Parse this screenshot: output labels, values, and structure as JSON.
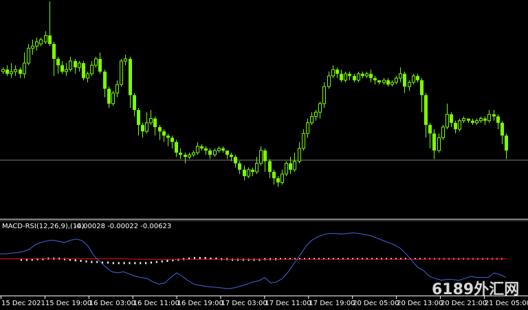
{
  "chart_data": [
    {
      "type": "candlestick",
      "colors": {
        "background": "#000000",
        "candle": "#7cfc00",
        "bid_line": "#808080"
      },
      "ylim": [
        0,
        1
      ],
      "bid_level": 0.255,
      "candles": [
        [
          0.67,
          0.68,
          0.66,
          0.69
        ],
        [
          0.68,
          0.66,
          0.65,
          0.7
        ],
        [
          0.66,
          0.67,
          0.64,
          0.71
        ],
        [
          0.67,
          0.68,
          0.65,
          0.7
        ],
        [
          0.68,
          0.66,
          0.64,
          0.69
        ],
        [
          0.66,
          0.71,
          0.64,
          0.76
        ],
        [
          0.71,
          0.78,
          0.7,
          0.8
        ],
        [
          0.78,
          0.79,
          0.75,
          0.82
        ],
        [
          0.79,
          0.81,
          0.77,
          0.83
        ],
        [
          0.8,
          0.82,
          0.79,
          0.83
        ],
        [
          0.81,
          0.84,
          0.8,
          0.86
        ],
        [
          0.84,
          0.8,
          0.79,
          1.0
        ],
        [
          0.8,
          0.73,
          0.65,
          0.81
        ],
        [
          0.73,
          0.7,
          0.66,
          0.74
        ],
        [
          0.7,
          0.67,
          0.66,
          0.72
        ],
        [
          0.67,
          0.68,
          0.65,
          0.71
        ],
        [
          0.68,
          0.72,
          0.67,
          0.74
        ],
        [
          0.72,
          0.69,
          0.66,
          0.73
        ],
        [
          0.69,
          0.71,
          0.67,
          0.72
        ],
        [
          0.71,
          0.64,
          0.63,
          0.72
        ],
        [
          0.64,
          0.66,
          0.62,
          0.67
        ],
        [
          0.66,
          0.7,
          0.65,
          0.72
        ],
        [
          0.7,
          0.73,
          0.69,
          0.74
        ],
        [
          0.73,
          0.67,
          0.66,
          0.76
        ],
        [
          0.67,
          0.59,
          0.55,
          0.68
        ],
        [
          0.59,
          0.52,
          0.5,
          0.6
        ],
        [
          0.52,
          0.57,
          0.51,
          0.58
        ],
        [
          0.57,
          0.61,
          0.55,
          0.63
        ],
        [
          0.61,
          0.72,
          0.6,
          0.73
        ],
        [
          0.72,
          0.73,
          0.7,
          0.75
        ],
        [
          0.73,
          0.56,
          0.5,
          0.74
        ],
        [
          0.56,
          0.49,
          0.46,
          0.57
        ],
        [
          0.49,
          0.42,
          0.37,
          0.5
        ],
        [
          0.42,
          0.39,
          0.36,
          0.43
        ],
        [
          0.39,
          0.43,
          0.38,
          0.48
        ],
        [
          0.43,
          0.45,
          0.42,
          0.49
        ],
        [
          0.45,
          0.41,
          0.37,
          0.46
        ],
        [
          0.41,
          0.39,
          0.35,
          0.42
        ],
        [
          0.39,
          0.37,
          0.34,
          0.4
        ],
        [
          0.37,
          0.36,
          0.32,
          0.38
        ],
        [
          0.36,
          0.34,
          0.31,
          0.37
        ],
        [
          0.34,
          0.29,
          0.27,
          0.35
        ],
        [
          0.29,
          0.28,
          0.26,
          0.31
        ],
        [
          0.28,
          0.27,
          0.24,
          0.29
        ],
        [
          0.27,
          0.28,
          0.26,
          0.29
        ],
        [
          0.28,
          0.29,
          0.27,
          0.3
        ],
        [
          0.29,
          0.32,
          0.28,
          0.34
        ],
        [
          0.32,
          0.31,
          0.3,
          0.33
        ],
        [
          0.31,
          0.3,
          0.28,
          0.32
        ],
        [
          0.3,
          0.28,
          0.26,
          0.31
        ],
        [
          0.28,
          0.3,
          0.27,
          0.31
        ],
        [
          0.3,
          0.31,
          0.29,
          0.32
        ],
        [
          0.31,
          0.3,
          0.29,
          0.32
        ],
        [
          0.3,
          0.28,
          0.26,
          0.3
        ],
        [
          0.28,
          0.27,
          0.25,
          0.29
        ],
        [
          0.27,
          0.24,
          0.22,
          0.28
        ],
        [
          0.24,
          0.21,
          0.19,
          0.25
        ],
        [
          0.21,
          0.18,
          0.16,
          0.23
        ],
        [
          0.18,
          0.21,
          0.17,
          0.22
        ],
        [
          0.21,
          0.2,
          0.18,
          0.22
        ],
        [
          0.2,
          0.24,
          0.19,
          0.27
        ],
        [
          0.24,
          0.3,
          0.23,
          0.32
        ],
        [
          0.3,
          0.25,
          0.2,
          0.31
        ],
        [
          0.25,
          0.2,
          0.17,
          0.26
        ],
        [
          0.2,
          0.17,
          0.14,
          0.21
        ],
        [
          0.17,
          0.15,
          0.13,
          0.18
        ],
        [
          0.15,
          0.19,
          0.14,
          0.21
        ],
        [
          0.19,
          0.24,
          0.18,
          0.25
        ],
        [
          0.24,
          0.21,
          0.19,
          0.27
        ],
        [
          0.21,
          0.25,
          0.2,
          0.29
        ],
        [
          0.25,
          0.31,
          0.24,
          0.34
        ],
        [
          0.31,
          0.38,
          0.3,
          0.4
        ],
        [
          0.38,
          0.43,
          0.36,
          0.45
        ],
        [
          0.43,
          0.46,
          0.42,
          0.48
        ],
        [
          0.46,
          0.48,
          0.44,
          0.49
        ],
        [
          0.48,
          0.52,
          0.45,
          0.53
        ],
        [
          0.52,
          0.6,
          0.5,
          0.62
        ],
        [
          0.6,
          0.65,
          0.59,
          0.67
        ],
        [
          0.65,
          0.68,
          0.64,
          0.7
        ],
        [
          0.68,
          0.66,
          0.64,
          0.69
        ],
        [
          0.66,
          0.63,
          0.62,
          0.68
        ],
        [
          0.63,
          0.66,
          0.62,
          0.67
        ],
        [
          0.66,
          0.65,
          0.63,
          0.67
        ],
        [
          0.65,
          0.63,
          0.62,
          0.66
        ],
        [
          0.63,
          0.66,
          0.62,
          0.67
        ],
        [
          0.66,
          0.65,
          0.64,
          0.67
        ],
        [
          0.65,
          0.66,
          0.64,
          0.67
        ],
        [
          0.66,
          0.64,
          0.62,
          0.68
        ],
        [
          0.64,
          0.63,
          0.61,
          0.65
        ],
        [
          0.63,
          0.62,
          0.61,
          0.63
        ],
        [
          0.62,
          0.63,
          0.61,
          0.64
        ],
        [
          0.63,
          0.61,
          0.6,
          0.64
        ],
        [
          0.61,
          0.62,
          0.6,
          0.63
        ],
        [
          0.62,
          0.64,
          0.61,
          0.65
        ],
        [
          0.64,
          0.66,
          0.62,
          0.69
        ],
        [
          0.66,
          0.6,
          0.57,
          0.67
        ],
        [
          0.6,
          0.62,
          0.58,
          0.63
        ],
        [
          0.62,
          0.65,
          0.61,
          0.66
        ],
        [
          0.65,
          0.63,
          0.62,
          0.66
        ],
        [
          0.63,
          0.56,
          0.48,
          0.64
        ],
        [
          0.56,
          0.42,
          0.36,
          0.57
        ],
        [
          0.42,
          0.38,
          0.31,
          0.43
        ],
        [
          0.38,
          0.3,
          0.26,
          0.4
        ],
        [
          0.3,
          0.36,
          0.29,
          0.38
        ],
        [
          0.36,
          0.41,
          0.35,
          0.42
        ],
        [
          0.41,
          0.47,
          0.4,
          0.52
        ],
        [
          0.47,
          0.43,
          0.41,
          0.48
        ],
        [
          0.43,
          0.4,
          0.38,
          0.44
        ],
        [
          0.4,
          0.44,
          0.39,
          0.45
        ],
        [
          0.44,
          0.45,
          0.43,
          0.46
        ],
        [
          0.45,
          0.44,
          0.43,
          0.45
        ],
        [
          0.44,
          0.43,
          0.42,
          0.45
        ],
        [
          0.43,
          0.44,
          0.42,
          0.45
        ],
        [
          0.44,
          0.45,
          0.43,
          0.46
        ],
        [
          0.45,
          0.44,
          0.42,
          0.46
        ],
        [
          0.44,
          0.47,
          0.43,
          0.49
        ],
        [
          0.47,
          0.46,
          0.44,
          0.49
        ],
        [
          0.46,
          0.43,
          0.4,
          0.47
        ],
        [
          0.43,
          0.37,
          0.33,
          0.44
        ],
        [
          0.37,
          0.3,
          0.26,
          0.38
        ]
      ]
    },
    {
      "type": "line",
      "name": "MACD-RSI(12,26,9),(14)",
      "values_label": "-0.00028 -0.00022 -0.00623",
      "colors": {
        "rsi": "#4169e1",
        "signal": "#ff0000",
        "macd_dots": "#ffffff"
      },
      "ylim": [
        0,
        1
      ],
      "rsi": [
        0.62,
        0.62,
        0.63,
        0.64,
        0.66,
        0.7,
        0.78,
        0.82,
        0.85,
        0.86,
        0.84,
        0.82,
        0.86,
        0.88,
        0.85,
        0.75,
        0.58,
        0.48,
        0.38,
        0.3,
        0.28,
        0.3,
        0.26,
        0.22,
        0.2,
        0.18,
        0.12,
        0.08,
        0.1,
        0.2,
        0.28,
        0.22,
        0.14,
        0.08,
        0.06,
        0.04,
        0.03,
        0.02,
        0.01,
        0.0,
        0.02,
        0.05,
        0.08,
        0.12,
        0.14,
        0.2,
        0.1,
        0.12,
        0.18,
        0.3,
        0.45,
        0.6,
        0.75,
        0.86,
        0.92,
        0.96,
        0.98,
        0.98,
        0.97,
        0.98,
        0.99,
        0.98,
        0.96,
        0.94,
        0.9,
        0.86,
        0.82,
        0.78,
        0.72,
        0.62,
        0.5,
        0.38,
        0.32,
        0.22,
        0.18,
        0.15,
        0.17,
        0.16,
        0.15,
        0.18,
        0.22,
        0.2,
        0.2,
        0.2,
        0.28,
        0.25,
        0.2
      ],
      "signal": [
        0.53,
        0.53,
        0.53,
        0.53,
        0.53,
        0.53,
        0.53,
        0.53,
        0.52,
        0.52,
        0.52,
        0.52,
        0.52,
        0.52,
        0.52,
        0.52,
        0.52,
        0.52,
        0.52,
        0.52,
        0.52,
        0.52,
        0.52,
        0.52,
        0.52,
        0.53,
        0.53,
        0.53,
        0.53,
        0.53
      ],
      "macd": [
        0.52,
        0.52,
        0.52,
        0.53,
        0.53,
        0.54,
        0.54,
        0.54,
        0.53,
        0.52,
        0.51,
        0.5,
        0.49,
        0.48,
        0.48,
        0.47,
        0.47,
        0.46,
        0.46,
        0.46,
        0.46,
        0.46,
        0.46,
        0.46,
        0.47,
        0.48,
        0.49,
        0.5,
        0.51,
        0.52,
        0.53,
        0.54,
        0.55,
        0.55,
        0.55,
        0.54,
        0.54,
        0.53,
        0.53,
        0.52,
        0.52,
        0.52,
        0.52,
        0.52,
        0.52,
        0.53,
        0.53,
        0.53
      ]
    }
  ],
  "x_axis": {
    "labels": [
      "15 Dec 2021",
      "15 Dec 19:00",
      "16 Dec 03:00",
      "16 Dec 11:00",
      "16 Dec 19:00",
      "17 Dec 03:00",
      "17 Dec 11:00",
      "17 Dec 19:00",
      "20 Dec 05:00",
      "20 Dec 13:00",
      "20 Dec 21:00",
      "21 Dec 05:00"
    ]
  },
  "watermark": "6189外汇网"
}
